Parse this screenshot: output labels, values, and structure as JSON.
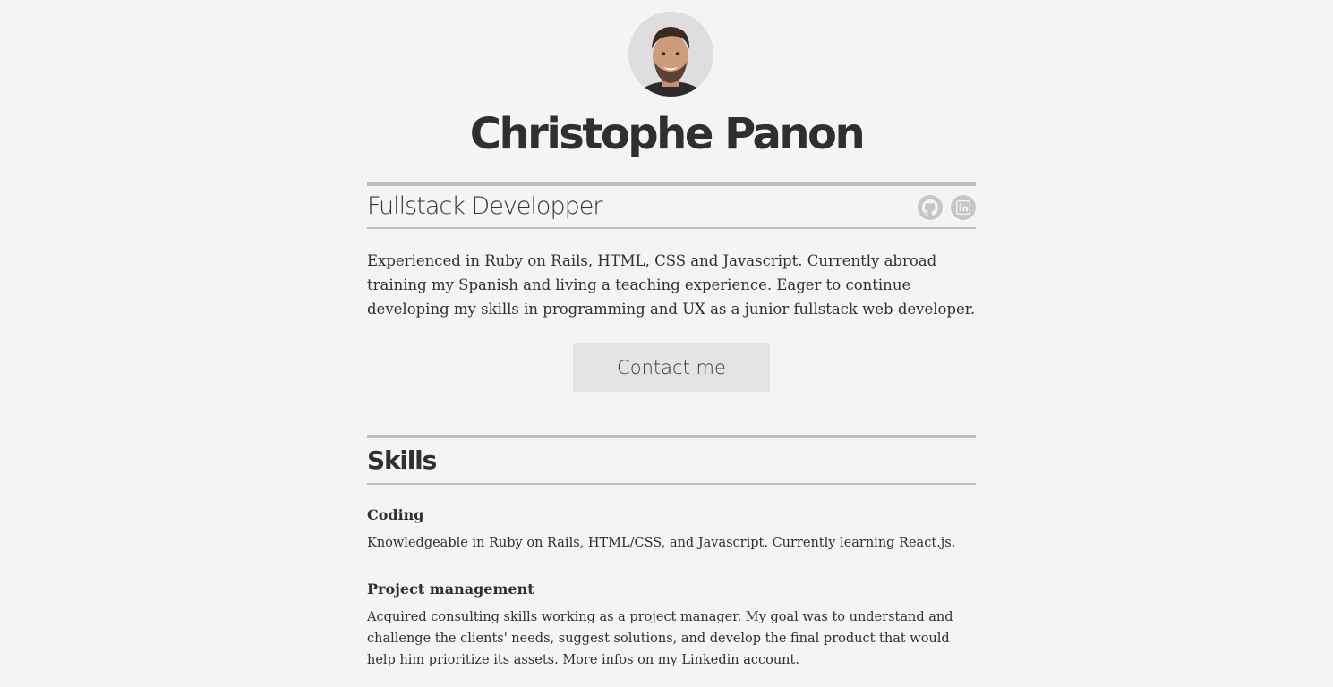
{
  "profile": {
    "name": "Christophe Panon",
    "role": "Fullstack Developper",
    "intro": "Experienced in Ruby on Rails, HTML, CSS and Javascript. Currently abroad training my Spanish and living a teaching experience. Eager to continue developing my skills in programming and UX as a junior fullstack web developer.",
    "contact_label": "Contact me"
  },
  "socials": [
    {
      "icon": "github-icon"
    },
    {
      "icon": "linkedin-icon"
    }
  ],
  "skills": {
    "title": "Skills",
    "items": [
      {
        "title": "Coding",
        "description": "Knowledgeable in Ruby on Rails, HTML/CSS, and Javascript. Currently learning React.js."
      },
      {
        "title": "Project management",
        "description": "Acquired consulting skills working as a project manager. My goal was to understand and challenge the clients' needs, suggest solutions, and develop the final product that would help him prioritize its assets. More infos on my Linkedin account."
      }
    ]
  },
  "colors": {
    "background": "#f4f4f4",
    "text": "#2f2f2f",
    "divider": "#bdbdbd",
    "button": "#e3e3e3",
    "icon": "#c6c6c6"
  }
}
